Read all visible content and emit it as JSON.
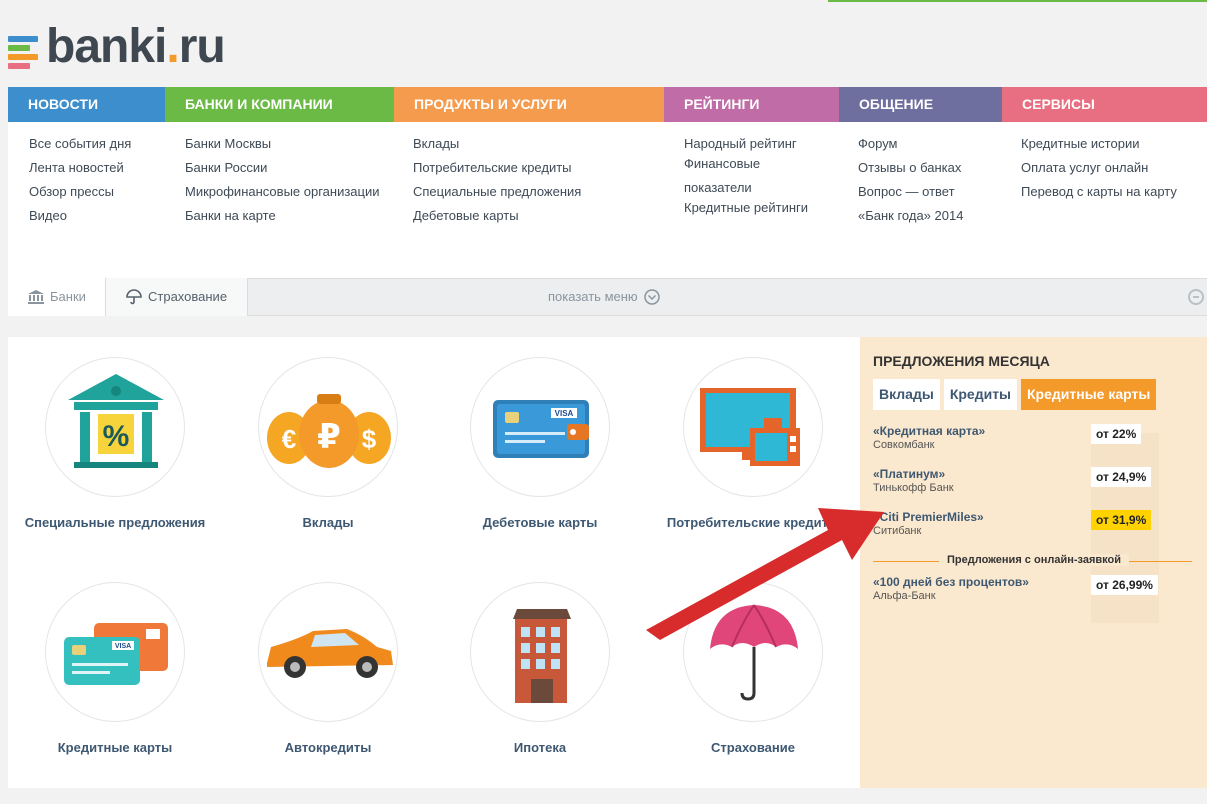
{
  "brand": {
    "name": "banki",
    "dot": ".",
    "tld": "ru"
  },
  "nav": [
    {
      "label": "Новости",
      "color": "#3d8ecc"
    },
    {
      "label": "Банки и компании",
      "color": "#6cba46"
    },
    {
      "label": "Продукты и услуги",
      "color": "#f59b4d"
    },
    {
      "label": "Рейтинги",
      "color": "#c06ca7"
    },
    {
      "label": "Общение",
      "color": "#6f6f9f"
    },
    {
      "label": "Сервисы",
      "color": "#e86f82"
    }
  ],
  "menu": [
    [
      "Все события дня",
      "Лента новостей",
      "Обзор прессы",
      "Видео"
    ],
    [
      "Банки Москвы",
      "Банки России",
      "Микрофинансовые организации",
      "Банки на карте"
    ],
    [
      "Вклады",
      "Потребительские кредиты",
      "Специальные предложения",
      "Дебетовые карты"
    ],
    [
      "Народный рейтинг",
      "Финансовые",
      "показатели",
      "Кредитные рейтинги"
    ],
    [
      "Форум",
      "Отзывы о банках",
      "Вопрос — ответ",
      "«Банк года» 2014"
    ],
    [
      "Кредитные истории",
      "Оплата услуг онлайн",
      "Перевод с карты на карту"
    ]
  ],
  "tabs": {
    "banks": "Банки",
    "insurance": "Страхование",
    "show_menu": "показать меню"
  },
  "products": [
    "Специальные предложения",
    "Вклады",
    "Дебетовые карты",
    "Потребительские кредиты",
    "Кредитные карты",
    "Автокредиты",
    "Ипотека",
    "Страхование"
  ],
  "offers": {
    "title": "Предложения месяца",
    "tabs": [
      "Вклады",
      "Кредиты",
      "Кредитные карты"
    ],
    "active_tab": "Кредитные карты",
    "items": [
      {
        "name": "«Кредитная карта»",
        "bank": "Совкомбанк",
        "rate": "от 22%"
      },
      {
        "name": "«Платинум»",
        "bank": "Тинькофф Банк",
        "rate": "от 24,9%"
      },
      {
        "name": "«Citi PremierMiles»",
        "bank": "Ситибанк",
        "rate": "от 31,9%"
      }
    ],
    "online_label": "Предложения с онлайн-заявкой",
    "online_items": [
      {
        "name": "«100 дней без процентов»",
        "bank": "Альфа-Банк",
        "rate": "от 26,99%"
      }
    ]
  },
  "colors": {
    "accent": "#f39a2b",
    "highlight": "#ffd200",
    "arrow": "#e53935"
  }
}
